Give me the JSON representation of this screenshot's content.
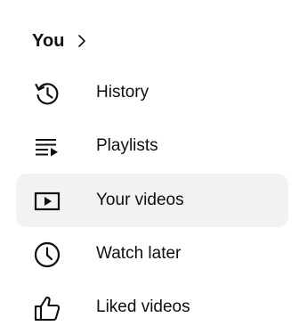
{
  "section": {
    "title": "You"
  },
  "items": [
    {
      "label": "History",
      "icon": "history-icon",
      "active": false
    },
    {
      "label": "Playlists",
      "icon": "playlists-icon",
      "active": false
    },
    {
      "label": "Your videos",
      "icon": "your-videos-icon",
      "active": true
    },
    {
      "label": "Watch later",
      "icon": "watch-later-icon",
      "active": false
    },
    {
      "label": "Liked videos",
      "icon": "liked-videos-icon",
      "active": false
    }
  ],
  "colors": {
    "text": "#0f0f0f",
    "active_bg": "#f2f2f2",
    "background": "#ffffff"
  }
}
